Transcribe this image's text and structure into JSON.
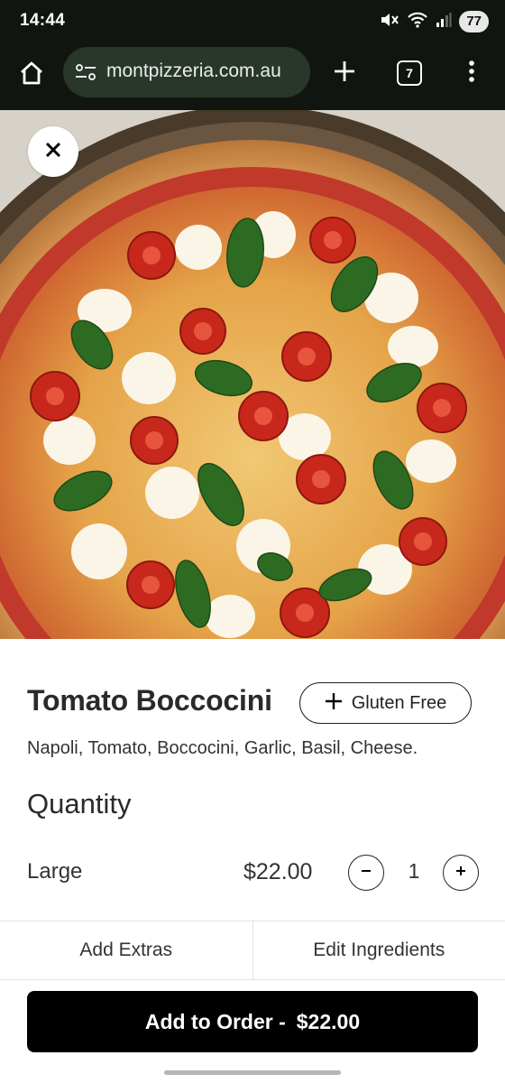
{
  "status_bar": {
    "time": "14:44",
    "battery": "77",
    "icons": [
      "mute-icon",
      "wifi-icon",
      "signal-icon"
    ]
  },
  "browser": {
    "url": "montpizzeria.com.au",
    "tab_count": "7",
    "icons": [
      "home-icon",
      "site-settings-icon",
      "new-tab-icon",
      "tab-switcher-icon",
      "more-menu-icon"
    ]
  },
  "hero": {
    "icon": "pizza-image",
    "close_icon": "close-icon"
  },
  "product": {
    "name": "Tomato Boccocini",
    "gluten_free_label": "Gluten Free",
    "description": "Napoli, Tomato, Boccocini, Garlic, Basil, Cheese."
  },
  "quantity": {
    "heading": "Quantity",
    "size": "Large",
    "price": "$22.00",
    "value": "1"
  },
  "tabs": [
    {
      "label": "Add Extras"
    },
    {
      "label": "Edit Ingredients"
    }
  ],
  "order": {
    "label": "Add to Order -",
    "total": "$22.00"
  },
  "colors": {
    "status_bg": "#101510",
    "url_pill_bg": "#28372a",
    "primary_button": "#000000",
    "text": "#222222"
  }
}
